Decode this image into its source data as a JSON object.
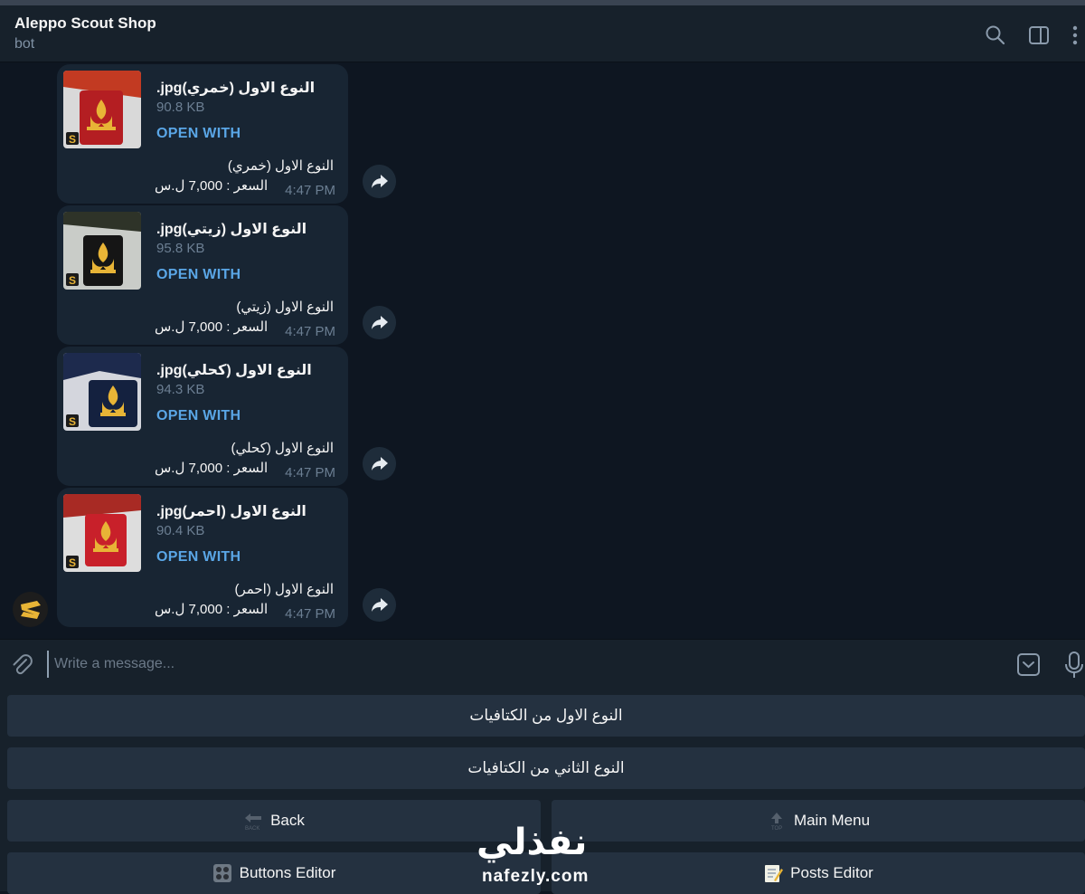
{
  "header": {
    "title": "Aleppo Scout Shop",
    "subtitle": "bot"
  },
  "messages": [
    {
      "file_name": ".jpgالنوع الاول (خمري)",
      "file_size": "90.8 KB",
      "open_with": "OPEN WITH",
      "caption_line1": "النوع الاول (خمري)",
      "caption_line2": "السعر : 7,000 ل.س",
      "time": "4:47 PM",
      "thumb_color": "#b41e22",
      "fabric_color": "#d9d9d9"
    },
    {
      "file_name": ".jpgالنوع الاول (زيتي)",
      "file_size": "95.8 KB",
      "open_with": "OPEN WITH",
      "caption_line1": "النوع الاول (زيتي)",
      "caption_line2": "السعر : 7,000 ل.س",
      "time": "4:47 PM",
      "thumb_color": "#151515",
      "fabric_color": "#c9ccc8"
    },
    {
      "file_name": ".jpgالنوع الاول (كحلي)",
      "file_size": "94.3 KB",
      "open_with": "OPEN WITH",
      "caption_line1": "النوع الاول (كحلي)",
      "caption_line2": "السعر : 7,000 ل.س",
      "time": "4:47 PM",
      "thumb_color": "#14213f",
      "fabric_color": "#d4d6dd"
    },
    {
      "file_name": ".jpgالنوع الاول (احمر)",
      "file_size": "90.4 KB",
      "open_with": "OPEN WITH",
      "caption_line1": "النوع الاول (احمر)",
      "caption_line2": "السعر : 7,000 ل.س",
      "time": "4:47 PM",
      "thumb_color": "#c8202a",
      "fabric_color": "#dddddd"
    }
  ],
  "composer": {
    "placeholder": "Write a message..."
  },
  "keyboard": {
    "row1": "النوع الاول من الكتافيات",
    "row2": "النوع الثاني من الكتافيات",
    "back": "Back",
    "main_menu": "Main Menu",
    "buttons_editor": "Buttons Editor",
    "posts_editor": "Posts Editor"
  },
  "watermark": {
    "arabic": "نفذلي",
    "latin": "nafezly.com"
  },
  "colors": {
    "background": "#0e1621",
    "panel": "#17212b",
    "bubble": "#182533",
    "accent_link": "#5aa6e6",
    "muted_text": "#6c7f93"
  }
}
